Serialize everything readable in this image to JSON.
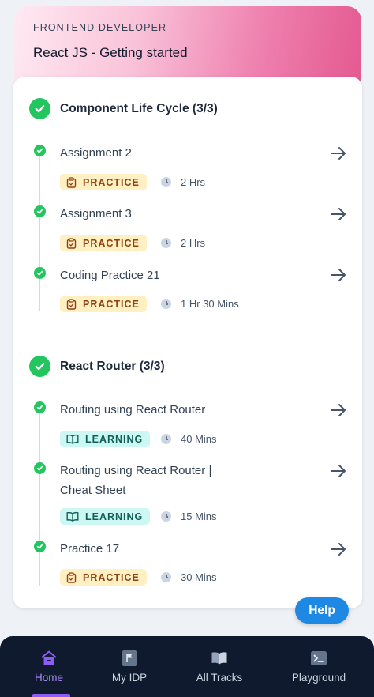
{
  "header": {
    "subtitle": "FRONTEND DEVELOPER",
    "title": "React JS - Getting started"
  },
  "sections": [
    {
      "title": "Component Life Cycle (3/3)",
      "items": [
        {
          "title": "Assignment 2",
          "badge": "PRACTICE",
          "duration": "2 Hrs"
        },
        {
          "title": "Assignment 3",
          "badge": "PRACTICE",
          "duration": "2 Hrs"
        },
        {
          "title": "Coding Practice 21",
          "badge": "PRACTICE",
          "duration": "1 Hr 30 Mins"
        }
      ]
    },
    {
      "title": "React Router (3/3)",
      "items": [
        {
          "title": "Routing using React Router",
          "badge": "LEARNING",
          "duration": "40 Mins"
        },
        {
          "title_line1": "Routing using React Router |",
          "title_line2": "Cheat Sheet",
          "badge": "LEARNING",
          "duration": "15 Mins"
        },
        {
          "title": "Practice 17",
          "badge": "PRACTICE",
          "duration": "30 Mins"
        }
      ]
    }
  ],
  "help_label": "Help",
  "nav": [
    {
      "label": "Home",
      "icon": "home-icon",
      "active": true
    },
    {
      "label": "My IDP",
      "icon": "flag-document-icon"
    },
    {
      "label": "All Tracks",
      "icon": "book-open-icon"
    },
    {
      "label": "Playground",
      "icon": "terminal-icon"
    }
  ],
  "colors": {
    "complete_green": "#22c55e",
    "practice_bg": "#fef0c2",
    "learning_bg": "#cdf7f3",
    "help_blue": "#1e88e5",
    "nav_bg": "#0f1a2e",
    "nav_active": "#8b5cf6"
  }
}
